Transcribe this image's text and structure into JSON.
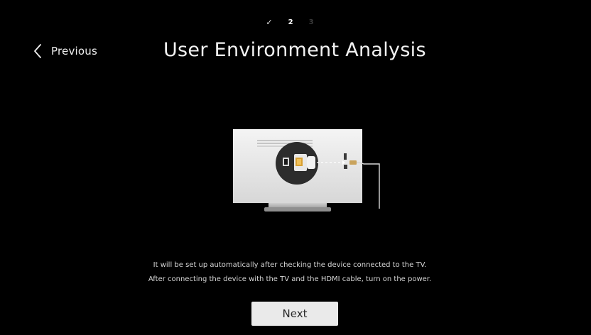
{
  "steps": {
    "done_mark": "✓",
    "current": "2",
    "upcoming": "3"
  },
  "header": {
    "previous_label": "Previous",
    "title": "User Environment Analysis"
  },
  "illustration": {
    "description_icon": "tv-hdmi-connection-icon"
  },
  "description": {
    "line1": "It will be set up automatically after checking the device connected to the TV.",
    "line2": "After connecting the device with the TV and the HDMI cable, turn on the power."
  },
  "actions": {
    "next_label": "Next"
  },
  "colors": {
    "background": "#000000",
    "button_bg": "#eaeaea",
    "text": "#ffffff"
  }
}
